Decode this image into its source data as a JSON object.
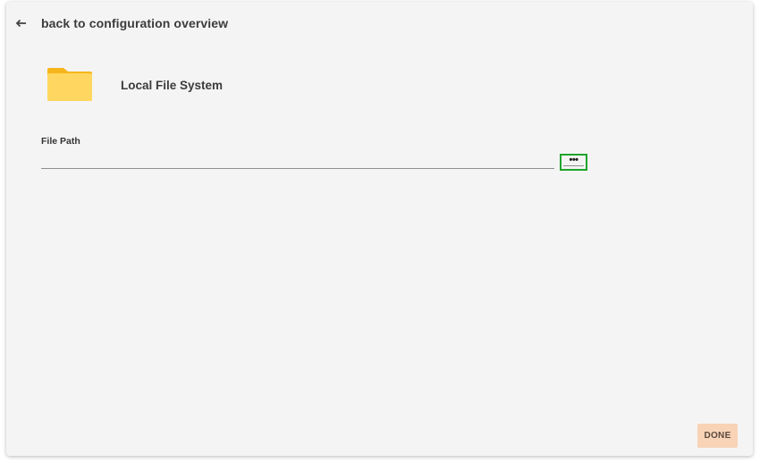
{
  "header": {
    "back_label": "back to configuration overview",
    "back_icon": "arrow-left-icon"
  },
  "source": {
    "title": "Local File System",
    "icon": "folder-icon"
  },
  "file_path": {
    "label": "File Path",
    "value": "",
    "browse_label": "•••"
  },
  "footer": {
    "done_label": "DONE"
  },
  "colors": {
    "folder_front": "#ffd760",
    "folder_back": "#f7b51c",
    "browse_highlight": "#1fa42b",
    "done_background": "#f8d3b6"
  }
}
